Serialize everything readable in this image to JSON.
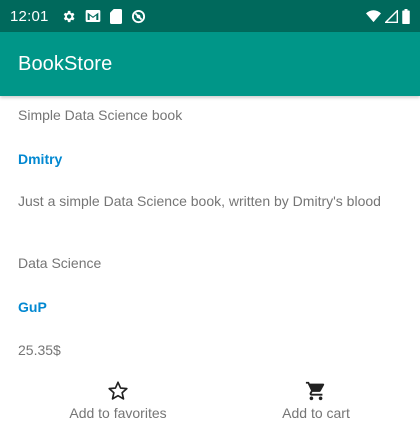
{
  "status_bar": {
    "time": "12:01",
    "icons": [
      "settings-icon",
      "gmail-icon",
      "sd-card-icon",
      "do-not-disturb-icon",
      "wifi-icon",
      "signal-icon",
      "battery-icon"
    ]
  },
  "app_bar": {
    "title": "BookStore"
  },
  "book": {
    "title": "Simple Data Science book",
    "author": "Dmitry",
    "description": "Just a simple Data Science book, written by Dmitry's blood",
    "genre": "Data Science",
    "publisher": "GuP",
    "price": "25.35$"
  },
  "actions": {
    "favorites_label": "Add to favorites",
    "favorites_icon": "star-outline-icon",
    "cart_label": "Add to cart",
    "cart_icon": "shopping-cart-icon"
  },
  "colors": {
    "status_bar": "#00695c",
    "app_bar": "#009688",
    "accent_text": "#0288d1",
    "body_text": "#757575"
  }
}
